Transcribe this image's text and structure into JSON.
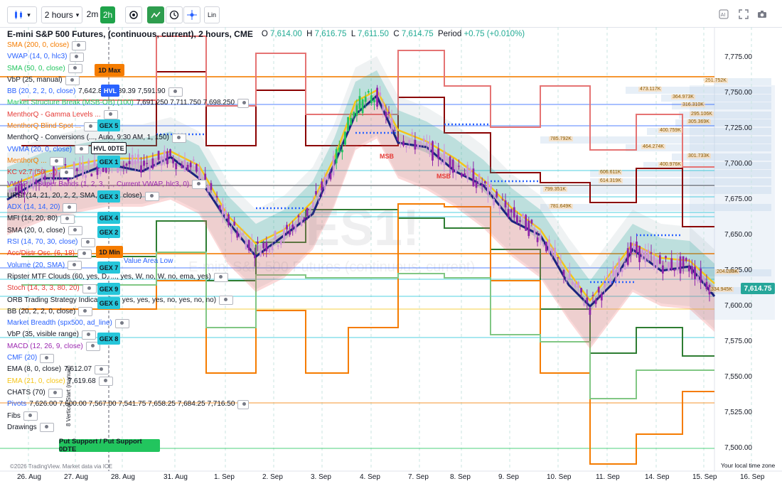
{
  "toolbar": {
    "interval": "2 hours",
    "tf_2m": "2m",
    "tf_2h": "2h",
    "lin_label": "Lin"
  },
  "header": {
    "title": "E-mini S&P 500 Futures, (continuous, current), 2 hours, CME",
    "o_label": "O",
    "o_value": "7,614.00",
    "h_label": "H",
    "h_value": "7,616.75",
    "l_label": "L",
    "l_value": "7,611.50",
    "c_label": "C",
    "c_value": "7,614.75",
    "period_label": "Period",
    "period_value": "+0.75 (+0.010%)"
  },
  "indicators": [
    {
      "name": "SMA (200, 0, close)",
      "color": "#f57c00"
    },
    {
      "name": "VWAP (14, 0, hlc3)",
      "color": "#2962ff"
    },
    {
      "name": "SMA (50, 0, close)",
      "color": "#22c55e"
    },
    {
      "name": "VbP (25, manual)",
      "color": "#131722"
    },
    {
      "name": "BB (20, 2, 2, 0, close)",
      "color": "#2962ff",
      "values": "7,642.83  7,689.39  7,591.90"
    },
    {
      "name": "Market Structure Break (MSB-OB) (100)",
      "color": "#22c55e",
      "values": "7,691.250  7,711.750  7,698.250"
    },
    {
      "name": "MenthorQ - Gamma Levels ...",
      "color": "#e53935"
    },
    {
      "name": "MenthorQ Blind Spot ...",
      "color": "#f57c00"
    },
    {
      "name": "MenthorQ - Conversions (..., Auto, 9:30 AM, 1, 150)",
      "color": "#131722"
    },
    {
      "name": "VWMA (20, 0, close)",
      "color": "#2962ff"
    },
    {
      "name": "MenthorQ ...",
      "color": "#f57c00"
    },
    {
      "name": "KC v2.7 (50, ...)",
      "color": "#e53935"
    },
    {
      "name": "VWAP ... Super Bands (1, 2, 3, ..., Current VWAP, hlc3, 0)",
      "color": "#9c27b0"
    },
    {
      "name": "URSI (14, 21, 20, 2, 2, SMA, 80, 20, close)",
      "color": "#131722"
    },
    {
      "name": "ADX (14, 14, 20)",
      "color": "#2962ff"
    },
    {
      "name": "MFI (14, 20, 80)",
      "color": "#131722"
    },
    {
      "name": "SMA (20, 0, close)",
      "color": "#131722"
    },
    {
      "name": "RSI (14, 70, 30, close)",
      "color": "#2962ff"
    },
    {
      "name": "Acc/Distr Osc. (6, 18)",
      "color": "#e53935"
    },
    {
      "name": "Volume (20, SMA)",
      "color": "#2962ff"
    },
    {
      "name": "Ripster MTF Clouds (60, yes, D, ..., yes, W, no, W, no, ema, yes)",
      "color": "#131722"
    },
    {
      "name": "Stoch (14, 3, 3, 80, 20)",
      "color": "#e53935"
    },
    {
      "name": "ORB Trading Strategy Indicator (no, yes, yes, yes, no, yes, no, no)",
      "color": "#131722"
    },
    {
      "name": "BB (20, 2, 2, 0, close)",
      "color": "#131722"
    },
    {
      "name": "Market Breadth (spx500, ad_line)",
      "color": "#2962ff"
    },
    {
      "name": "VbP (35, visible range)",
      "color": "#131722"
    },
    {
      "name": "MACD (12, 26, 9, close)",
      "color": "#9c27b0"
    },
    {
      "name": "CMF (20)",
      "color": "#2962ff"
    },
    {
      "name": "EMA (8, 0, close)",
      "color": "#131722",
      "values": "7,612.07"
    },
    {
      "name": "EMA (21, 0, close)",
      "color": "#f5c518",
      "values": "7,619.68"
    },
    {
      "name": "CHATS (70)",
      "color": "#131722"
    },
    {
      "name": "Pivots",
      "color": "#2962ff",
      "values": "7,626.00  7,600.00  7,567.00  7,541.75  7,658.25  7,684.25  7,716.50"
    },
    {
      "name": "Fibs",
      "color": "#131722"
    },
    {
      "name": "Drawings",
      "color": "#131722"
    }
  ],
  "labels": {
    "d1_max": "1D Max",
    "d1_min": "1D Min",
    "hvl": "HVL",
    "hvl_0dte": "HVL 0DTE",
    "gex5": "GEX 5",
    "gex1": "GEX 1",
    "gex3": "GEX 3",
    "gex4": "GEX 4",
    "gex2": "GEX 2",
    "gex7": "GEX 7",
    "gex9": "GEX 9",
    "gex6": "GEX 6",
    "gex8": "GEX 8",
    "put_support": "Put Support / Put Support 0DTE",
    "value_area_low": "Value Area Low",
    "msb": "MSB",
    "watermark": "ES1!",
    "watermark_sub": "E-mini S&P 500 Futures (continuous, current)",
    "copyright": "©2026 TradingView. Market data via ICE",
    "vertical_note": "8 Vertical Start (manual)",
    "timezone": "Your local time zone",
    "last_price": "7,614.75"
  },
  "price_axis": [
    "7,775.00",
    "7,750.00",
    "7,725.00",
    "7,700.00",
    "7,675.00",
    "7,650.00",
    "7,625.00",
    "7,600.00",
    "7,575.00",
    "7,550.00",
    "7,525.00",
    "7,500.00"
  ],
  "date_axis": [
    "26. Aug",
    "27. Aug",
    "28. Aug",
    "31. Aug",
    "1. Sep",
    "2. Sep",
    "3. Sep",
    "4. Sep",
    "7. Sep",
    "8. Sep",
    "9. Sep",
    "10. Sep",
    "11. Sep",
    "14. Sep",
    "15. Sep",
    "16. Sep"
  ],
  "volume_profile": [
    "251.752K",
    "473.117K",
    "364.973K",
    "316.310K",
    "295.106K",
    "305.369K",
    "400.759K",
    "785.792K",
    "464.274K",
    "301.733K",
    "400.976K",
    "606.611K",
    "614.319K",
    "799.351K",
    "781.649K",
    "204.285K",
    "334.945K"
  ],
  "colors": {
    "up": "#26a69a",
    "down": "#ef5350",
    "candle": "#9c27b0",
    "ema8": "#1a237e",
    "ema21": "#f5c518",
    "orange": "#f57c00",
    "darkred": "#8b0000",
    "green": "#2e7d32",
    "accent": "#2962ff"
  }
}
